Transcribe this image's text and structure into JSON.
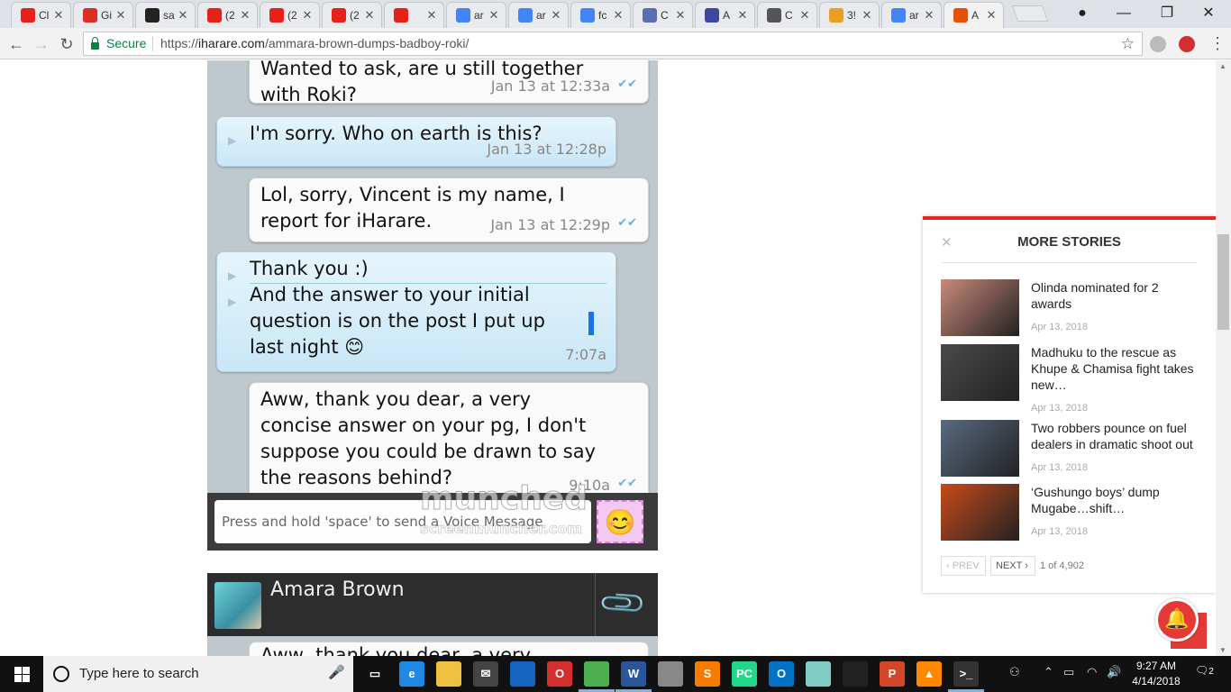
{
  "tabs": [
    {
      "label": "Cl",
      "favicon": "youtube-icon",
      "color": "#e62117"
    },
    {
      "label": "Gi",
      "favicon": "gmail-icon",
      "color": "#d93025"
    },
    {
      "label": "sa",
      "favicon": "github-icon",
      "color": "#222222"
    },
    {
      "label": "(2",
      "favicon": "youtube-icon",
      "color": "#e62117"
    },
    {
      "label": "(2",
      "favicon": "youtube-icon",
      "color": "#e62117"
    },
    {
      "label": "(2",
      "favicon": "youtube-icon",
      "color": "#e62117"
    },
    {
      "label": "",
      "favicon": "youtube-audio-icon",
      "color": "#e62117"
    },
    {
      "label": "ar",
      "favicon": "google-icon",
      "color": "#4285f4"
    },
    {
      "label": "ar",
      "favicon": "google-icon",
      "color": "#4285f4"
    },
    {
      "label": "fc",
      "favicon": "google-icon",
      "color": "#4285f4"
    },
    {
      "label": "C",
      "favicon": "chromium-icon",
      "color": "#5b6fb0"
    },
    {
      "label": "A",
      "favicon": "s-icon",
      "color": "#3b4aa0"
    },
    {
      "label": "C",
      "favicon": "wikipedia-icon",
      "color": "#555555"
    },
    {
      "label": "3!",
      "favicon": "her-icon",
      "color": "#e8a020"
    },
    {
      "label": "ar",
      "favicon": "google-icon",
      "color": "#4285f4"
    },
    {
      "label": "A",
      "favicon": "fire-icon",
      "color": "#e65100"
    }
  ],
  "omnibox": {
    "secure_label": "Secure",
    "url_scheme": "https://",
    "url_host": "iharare.com",
    "url_path": "/ammara-brown-dumps-badboy-roki/"
  },
  "chat": {
    "bubbles": [
      {
        "dir": "out",
        "lines": [
          "Wanted to ask, are u still together",
          "with Roki?"
        ],
        "time": "Jan 13 at 12:33a"
      },
      {
        "dir": "in",
        "lines": [
          "I'm sorry.  Who on earth is this?"
        ],
        "time": "Jan 13 at 12:28p"
      },
      {
        "dir": "out",
        "lines": [
          "Lol, sorry, Vincent is my name, I",
          "report for iHarare."
        ],
        "time": "Jan 13 at 12:29p"
      },
      {
        "dir": "in",
        "lines": [
          "Thank you :)",
          "And the answer to your initial",
          "question is on the post I put up",
          "last night 😊"
        ],
        "time": "7:07a"
      },
      {
        "dir": "out",
        "lines": [
          "Aww, thank you dear, a very",
          "concise answer on your pg, I don't",
          "suppose you could be drawn to say",
          "the reasons behind?"
        ],
        "time": "9:10a"
      }
    ],
    "composer_placeholder": "Press and hold 'space' to send a Voice Message",
    "watermark_big": "munched",
    "watermark_small": "screenmuncher.com",
    "second_contact_name": "Amara Brown",
    "second_preview": "Aww, thank you dear, a very"
  },
  "more_stories": {
    "title": "MORE STORIES",
    "items": [
      {
        "title": "Olinda nominated for 2 awards",
        "date": "Apr 13, 2018",
        "thumb": "#c98a7a"
      },
      {
        "title": "Madhuku to the rescue as Khupe & Chamisa fight takes new…",
        "date": "Apr 13, 2018",
        "thumb": "#4a4a4a"
      },
      {
        "title": "Two robbers pounce on fuel dealers in dramatic shoot out",
        "date": "Apr 13, 2018",
        "thumb": "#5a6a80"
      },
      {
        "title": "‘Gushungo boys’ dump Mugabe…shift…",
        "date": "Apr 13, 2018",
        "thumb": "#c84a1a"
      }
    ],
    "prev_label": "‹ PREV",
    "next_label": "NEXT ›",
    "count": "1 of 4,902"
  },
  "taskbar": {
    "search_placeholder": "Type here to search",
    "time": "9:27 AM",
    "date": "4/14/2018",
    "notifications": "2",
    "apps": [
      {
        "name": "task-view-icon",
        "label": "▭",
        "color": "#111111"
      },
      {
        "name": "edge-icon",
        "label": "e",
        "color": "#1e88e5"
      },
      {
        "name": "file-explorer-icon",
        "label": "",
        "color": "#f0c040"
      },
      {
        "name": "mail-icon",
        "label": "✉",
        "color": "#444444"
      },
      {
        "name": "photoshop-like-icon",
        "label": "",
        "color": "#1565c0"
      },
      {
        "name": "opera-icon",
        "label": "O",
        "color": "#d32f2f"
      },
      {
        "name": "chrome-icon",
        "label": "",
        "color": "#4caf50"
      },
      {
        "name": "word-icon",
        "label": "W",
        "color": "#2b579a"
      },
      {
        "name": "paint-icon",
        "label": "",
        "color": "#888888"
      },
      {
        "name": "sublime-icon",
        "label": "S",
        "color": "#f57c00"
      },
      {
        "name": "pycharm-icon",
        "label": "PC",
        "color": "#21d789"
      },
      {
        "name": "outlook-icon",
        "label": "O",
        "color": "#0072c6"
      },
      {
        "name": "notepad-icon",
        "label": "",
        "color": "#80cbc4"
      },
      {
        "name": "photos-icon",
        "label": "",
        "color": "#222222"
      },
      {
        "name": "powerpoint-icon",
        "label": "P",
        "color": "#d24726"
      },
      {
        "name": "vlc-icon",
        "label": "▲",
        "color": "#ff8800"
      },
      {
        "name": "terminal-icon",
        "label": ">_",
        "color": "#333333"
      }
    ]
  }
}
